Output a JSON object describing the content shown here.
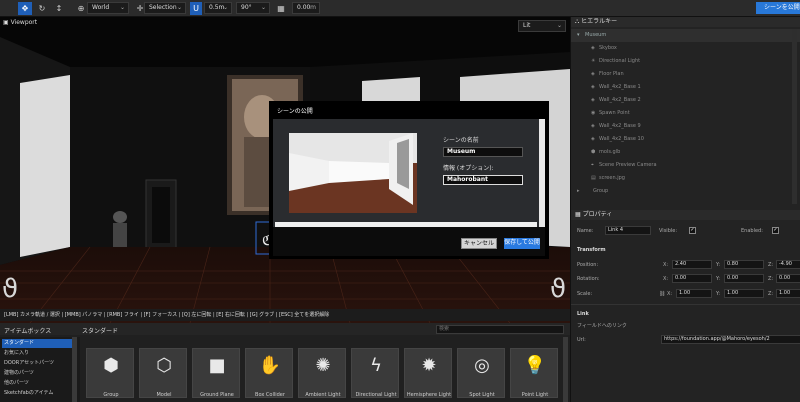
{
  "toolbar": {
    "space_select": "World",
    "mode_select": "Selection",
    "snap_value": "0.5m",
    "angle_value": "90°",
    "grid_value": "0.00",
    "grid_unit": "m",
    "publish_label": "シーンを公開"
  },
  "viewport": {
    "title": "Viewport",
    "lit_select": "Lit",
    "hint": "[LMB] カメラ軌道 / 選択 | [MMB] パノラマ | [RMB] フライ | [F] フォーカス | [Q] 左に回転 | [E] 右に回転 | [G] グラブ | [ESC] 全てを選択解除"
  },
  "modal": {
    "title": "シーンの公開",
    "name_label": "シーンの名前",
    "name_value": "Museum",
    "info_label": "情報 (オプション):",
    "info_value": "Mahorobant",
    "cancel_label": "キャンセル",
    "save_label": "保存して公開"
  },
  "hierarchy": {
    "title": "ヒエラルキー",
    "root": "Museum",
    "items": [
      {
        "label": "Skybox",
        "icon": "cube-icon"
      },
      {
        "label": "Directional Light",
        "icon": "light-icon"
      },
      {
        "label": "Floor Plan",
        "icon": "cube-icon"
      },
      {
        "label": "Wall_4x2_Base 1",
        "icon": "cube-icon"
      },
      {
        "label": "Wall_4x2_Base 2",
        "icon": "cube-icon"
      },
      {
        "label": "Spawn Point",
        "icon": "point-icon"
      },
      {
        "label": "Wall_4x2_Base 9",
        "icon": "cube-icon"
      },
      {
        "label": "Wall_4x2_Base 10",
        "icon": "cube-icon"
      },
      {
        "label": "mols.glb",
        "icon": "model-icon"
      },
      {
        "label": "Scene Preview Camera",
        "icon": "camera-icon"
      },
      {
        "label": "screen.jpg",
        "icon": "image-icon"
      },
      {
        "label": "Group",
        "icon": "group-icon"
      }
    ]
  },
  "properties": {
    "title": "プロパティ",
    "name_label": "Name:",
    "name_value": "Link 4",
    "visible_label": "Visible:",
    "enabled_label": "Enabled:",
    "transform_title": "Transform",
    "position_label": "Position:",
    "rotation_label": "Rotation:",
    "scale_label": "Scale:",
    "position": {
      "x": "2.40",
      "y": "0.80",
      "z": "-4.90"
    },
    "rotation": {
      "x": "0.00",
      "y": "0.00",
      "z": "0.00"
    },
    "scale": {
      "x": "1.00",
      "y": "1.00",
      "z": "1.00"
    },
    "axis_x": "X:",
    "axis_y": "Y:",
    "axis_z": "Z:",
    "link_title": "Link",
    "link_sub": "フィールドへのリンク",
    "url_label": "Url:",
    "url_value": "https://foundation.app/@Mahoro/eyesoh/2"
  },
  "assets": {
    "title": "アイテムボックス",
    "tab": "スタンダード",
    "search_placeholder": "検索",
    "categories": [
      "スタンダード",
      "お気に入り",
      "DOORアセットパーツ",
      "建物のパーツ",
      "他のパーツ",
      "Sketchfabのアイテム"
    ],
    "items": [
      {
        "label": "Group",
        "icon": "group-icon",
        "glyph": "⬢"
      },
      {
        "label": "Model",
        "icon": "model-icon",
        "glyph": "⬡"
      },
      {
        "label": "Ground Plane",
        "icon": "ground-plane-icon",
        "glyph": "■"
      },
      {
        "label": "Box Collider",
        "icon": "hand-icon",
        "glyph": "✋"
      },
      {
        "label": "Ambient Light",
        "icon": "sun-icon",
        "glyph": "✺"
      },
      {
        "label": "Directional Light",
        "icon": "bolt-icon",
        "glyph": "ϟ"
      },
      {
        "label": "Hemisphere Light",
        "icon": "hemisphere-icon",
        "glyph": "✹"
      },
      {
        "label": "Spot Light",
        "icon": "target-icon",
        "glyph": "◎"
      },
      {
        "label": "Point Light",
        "icon": "bulb-icon",
        "glyph": "💡"
      }
    ]
  }
}
